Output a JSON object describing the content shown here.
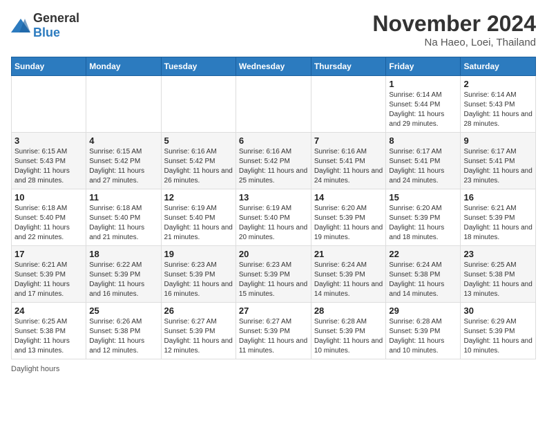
{
  "header": {
    "logo_general": "General",
    "logo_blue": "Blue",
    "title": "November 2024",
    "subtitle": "Na Haeo, Loei, Thailand"
  },
  "footer": {
    "note": "Daylight hours"
  },
  "weekdays": [
    "Sunday",
    "Monday",
    "Tuesday",
    "Wednesday",
    "Thursday",
    "Friday",
    "Saturday"
  ],
  "weeks": [
    [
      {
        "day": "",
        "info": ""
      },
      {
        "day": "",
        "info": ""
      },
      {
        "day": "",
        "info": ""
      },
      {
        "day": "",
        "info": ""
      },
      {
        "day": "",
        "info": ""
      },
      {
        "day": "1",
        "info": "Sunrise: 6:14 AM\nSunset: 5:44 PM\nDaylight: 11 hours and 29 minutes."
      },
      {
        "day": "2",
        "info": "Sunrise: 6:14 AM\nSunset: 5:43 PM\nDaylight: 11 hours and 28 minutes."
      }
    ],
    [
      {
        "day": "3",
        "info": "Sunrise: 6:15 AM\nSunset: 5:43 PM\nDaylight: 11 hours and 28 minutes."
      },
      {
        "day": "4",
        "info": "Sunrise: 6:15 AM\nSunset: 5:42 PM\nDaylight: 11 hours and 27 minutes."
      },
      {
        "day": "5",
        "info": "Sunrise: 6:16 AM\nSunset: 5:42 PM\nDaylight: 11 hours and 26 minutes."
      },
      {
        "day": "6",
        "info": "Sunrise: 6:16 AM\nSunset: 5:42 PM\nDaylight: 11 hours and 25 minutes."
      },
      {
        "day": "7",
        "info": "Sunrise: 6:16 AM\nSunset: 5:41 PM\nDaylight: 11 hours and 24 minutes."
      },
      {
        "day": "8",
        "info": "Sunrise: 6:17 AM\nSunset: 5:41 PM\nDaylight: 11 hours and 24 minutes."
      },
      {
        "day": "9",
        "info": "Sunrise: 6:17 AM\nSunset: 5:41 PM\nDaylight: 11 hours and 23 minutes."
      }
    ],
    [
      {
        "day": "10",
        "info": "Sunrise: 6:18 AM\nSunset: 5:40 PM\nDaylight: 11 hours and 22 minutes."
      },
      {
        "day": "11",
        "info": "Sunrise: 6:18 AM\nSunset: 5:40 PM\nDaylight: 11 hours and 21 minutes."
      },
      {
        "day": "12",
        "info": "Sunrise: 6:19 AM\nSunset: 5:40 PM\nDaylight: 11 hours and 21 minutes."
      },
      {
        "day": "13",
        "info": "Sunrise: 6:19 AM\nSunset: 5:40 PM\nDaylight: 11 hours and 20 minutes."
      },
      {
        "day": "14",
        "info": "Sunrise: 6:20 AM\nSunset: 5:39 PM\nDaylight: 11 hours and 19 minutes."
      },
      {
        "day": "15",
        "info": "Sunrise: 6:20 AM\nSunset: 5:39 PM\nDaylight: 11 hours and 18 minutes."
      },
      {
        "day": "16",
        "info": "Sunrise: 6:21 AM\nSunset: 5:39 PM\nDaylight: 11 hours and 18 minutes."
      }
    ],
    [
      {
        "day": "17",
        "info": "Sunrise: 6:21 AM\nSunset: 5:39 PM\nDaylight: 11 hours and 17 minutes."
      },
      {
        "day": "18",
        "info": "Sunrise: 6:22 AM\nSunset: 5:39 PM\nDaylight: 11 hours and 16 minutes."
      },
      {
        "day": "19",
        "info": "Sunrise: 6:23 AM\nSunset: 5:39 PM\nDaylight: 11 hours and 16 minutes."
      },
      {
        "day": "20",
        "info": "Sunrise: 6:23 AM\nSunset: 5:39 PM\nDaylight: 11 hours and 15 minutes."
      },
      {
        "day": "21",
        "info": "Sunrise: 6:24 AM\nSunset: 5:39 PM\nDaylight: 11 hours and 14 minutes."
      },
      {
        "day": "22",
        "info": "Sunrise: 6:24 AM\nSunset: 5:38 PM\nDaylight: 11 hours and 14 minutes."
      },
      {
        "day": "23",
        "info": "Sunrise: 6:25 AM\nSunset: 5:38 PM\nDaylight: 11 hours and 13 minutes."
      }
    ],
    [
      {
        "day": "24",
        "info": "Sunrise: 6:25 AM\nSunset: 5:38 PM\nDaylight: 11 hours and 13 minutes."
      },
      {
        "day": "25",
        "info": "Sunrise: 6:26 AM\nSunset: 5:38 PM\nDaylight: 11 hours and 12 minutes."
      },
      {
        "day": "26",
        "info": "Sunrise: 6:27 AM\nSunset: 5:39 PM\nDaylight: 11 hours and 12 minutes."
      },
      {
        "day": "27",
        "info": "Sunrise: 6:27 AM\nSunset: 5:39 PM\nDaylight: 11 hours and 11 minutes."
      },
      {
        "day": "28",
        "info": "Sunrise: 6:28 AM\nSunset: 5:39 PM\nDaylight: 11 hours and 10 minutes."
      },
      {
        "day": "29",
        "info": "Sunrise: 6:28 AM\nSunset: 5:39 PM\nDaylight: 11 hours and 10 minutes."
      },
      {
        "day": "30",
        "info": "Sunrise: 6:29 AM\nSunset: 5:39 PM\nDaylight: 11 hours and 10 minutes."
      }
    ]
  ]
}
